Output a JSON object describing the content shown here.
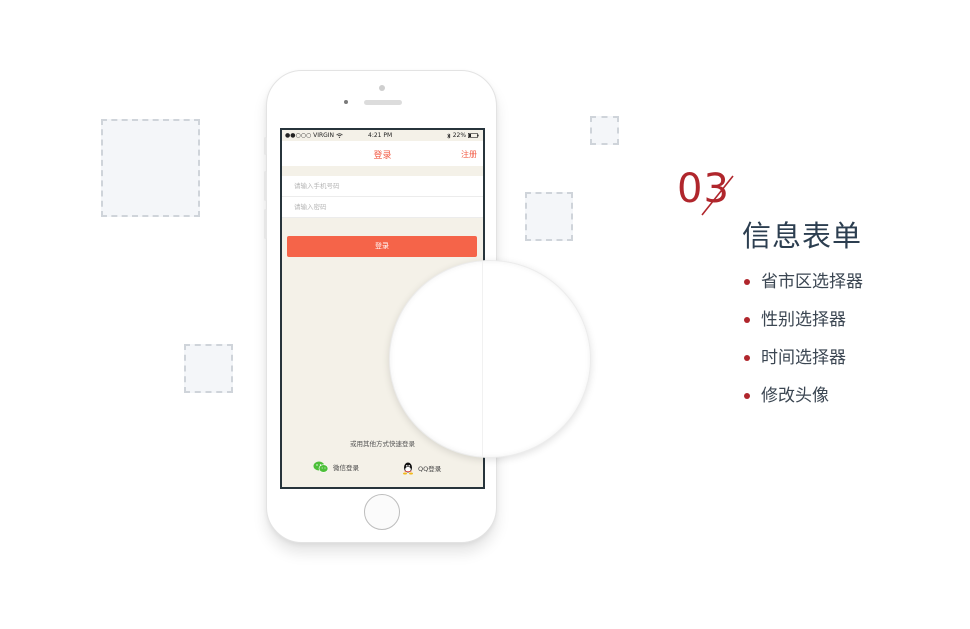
{
  "statusbar": {
    "carrier": "●●○○○ VIRGIN",
    "time": "4:21 PM",
    "battery": "22%"
  },
  "app": {
    "nav_title": "登录",
    "nav_right": "注册",
    "phone_placeholder": "请输入手机号码",
    "password_placeholder": "请输入密码",
    "login_button": "登录",
    "other_login_label": "或用其他方式快速登录",
    "wechat_label": "微信登录",
    "qq_label": "QQ登录"
  },
  "slide": {
    "number": "03",
    "title": "信息表单",
    "features": [
      "省市区选择器",
      "性别选择器",
      "时间选择器",
      "修改头像"
    ]
  },
  "colors": {
    "accent": "#b0262c",
    "brand": "#f56449",
    "wechat": "#4cbf38"
  },
  "icons": [
    "wifi-icon",
    "bluetooth-icon",
    "battery-icon",
    "wechat-icon",
    "qq-icon"
  ]
}
